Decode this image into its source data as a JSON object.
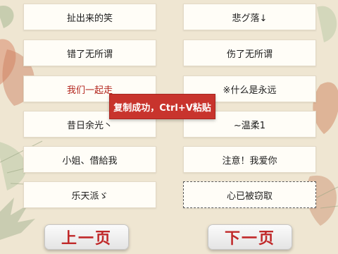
{
  "items": [
    "扯出来的笑",
    "悲グ落↓",
    "错了无所谓",
    "伤了无所谓",
    "我们一起走",
    "※什么是永远",
    "昔日余光丶",
    "~温柔1",
    "小姐、借給我",
    "注意！我爱你",
    "乐天派ゞ",
    "心已被窃取"
  ],
  "toast": "复制成功，Ctrl+V粘贴",
  "nav": {
    "prev": "上一页",
    "next": "下一页"
  },
  "colors": {
    "accent": "#c8342d",
    "button_text": "#c0292a"
  }
}
